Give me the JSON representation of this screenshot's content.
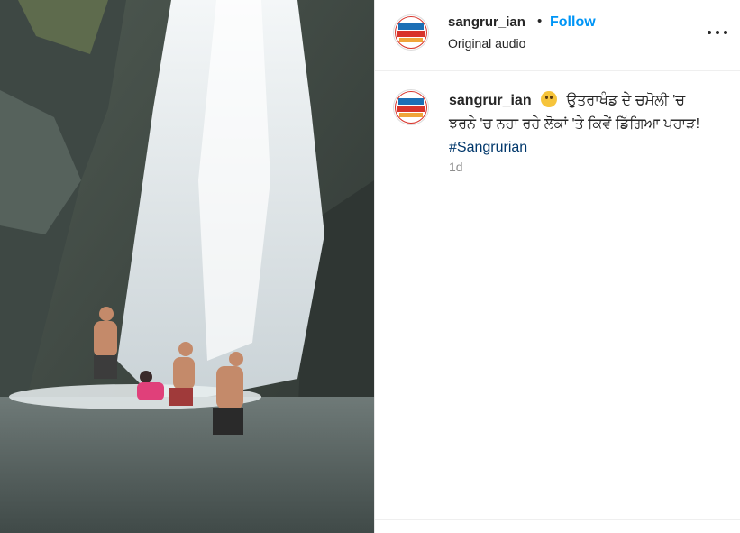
{
  "post": {
    "username": "sangrur_ian",
    "follow_label": "Follow",
    "audio": "Original audio",
    "avatar_logo_text": [
      "SANGRUR",
      "DISTRICT",
      "Sangrurian"
    ],
    "caption_text": "ਉਤਰਾਖੰਡ ਦੇ ਚਮੋਲੀ 'ਚ ਝਰਨੇ 'ਚ ਨਹਾ ਰਹੇ ਲੋਕਾਂ 'ਤੇ ਕਿਵੇਂ ਡਿੱਗਿਆ ਪਹਾੜ!",
    "hashtag": "#Sangrurian",
    "emoji_icon": "flushed-face-emoji",
    "time": "1d"
  },
  "colors": {
    "follow": "#0095f6",
    "hashtag": "#00376b",
    "muted": "#8e8e8e",
    "text": "#262626"
  }
}
